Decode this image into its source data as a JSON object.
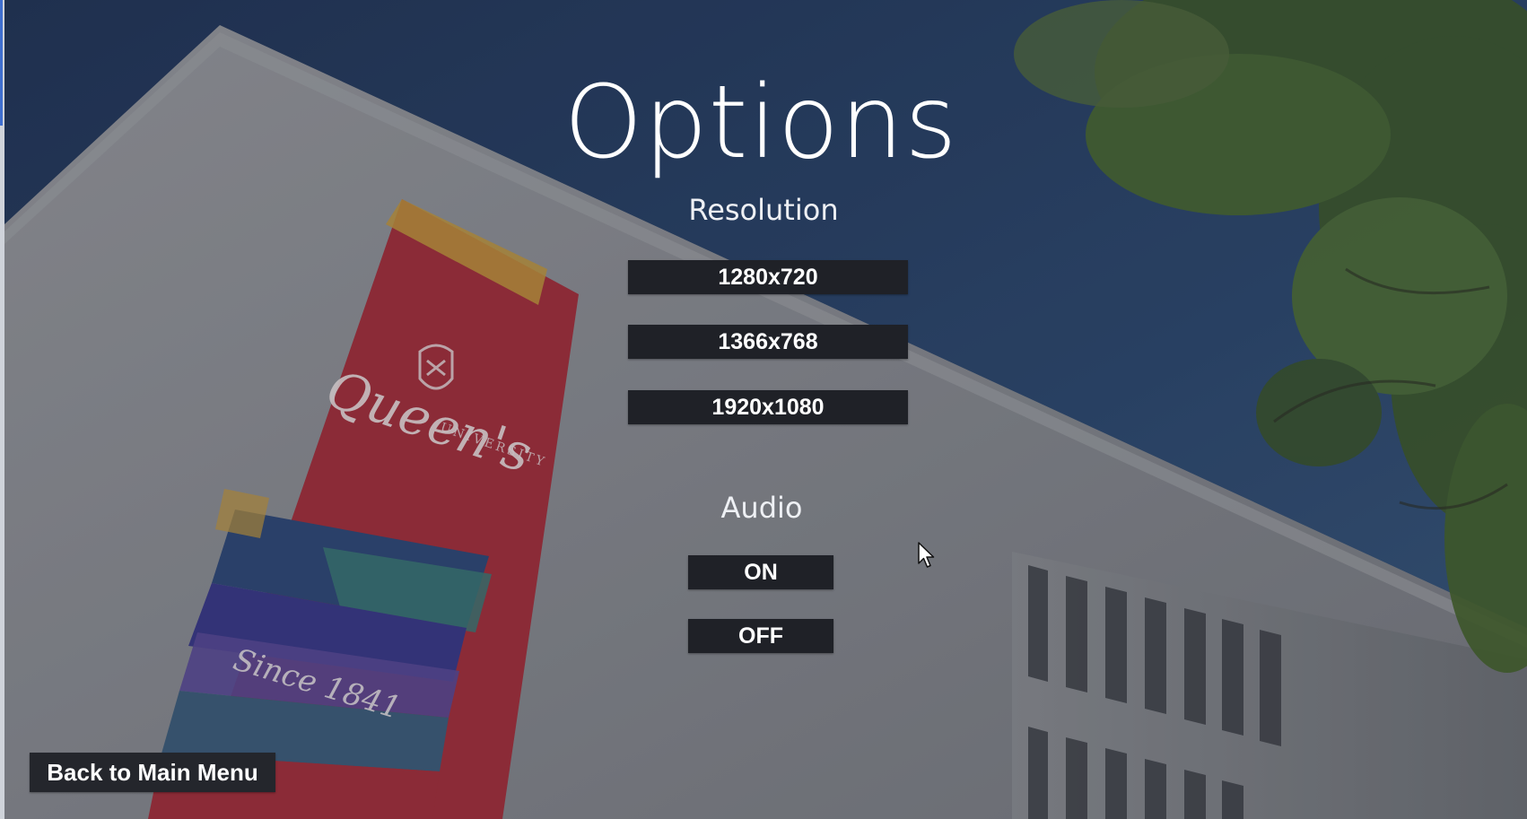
{
  "menu": {
    "title": "Options",
    "resolution_heading": "Resolution",
    "resolutions": [
      "1280x720",
      "1366x768",
      "1920x1080"
    ],
    "audio_heading": "Audio",
    "audio_on_label": "ON",
    "audio_off_label": "OFF",
    "back_label": "Back to Main Menu"
  },
  "background": {
    "banner_text": "Queen's",
    "banner_subtext": "UNIVERSITY",
    "banner_footer": "Since 1841",
    "sky_color": "#2c4468",
    "wall_color": "#8d9096",
    "banner_red": "#a5303d"
  },
  "icons": {
    "cursor": "mouse-pointer-icon"
  }
}
